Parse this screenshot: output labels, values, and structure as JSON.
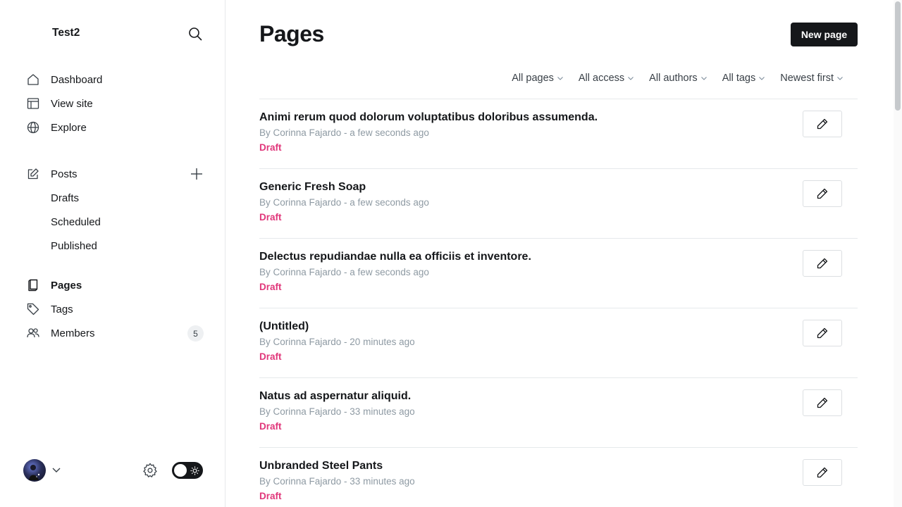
{
  "sidebar": {
    "site_title": "Test2",
    "nav": [
      {
        "label": "Dashboard",
        "icon": "home-icon"
      },
      {
        "label": "View site",
        "icon": "layout-icon"
      },
      {
        "label": "Explore",
        "icon": "globe-icon"
      }
    ],
    "posts": {
      "label": "Posts",
      "subitems": [
        "Drafts",
        "Scheduled",
        "Published"
      ]
    },
    "pages_label": "Pages",
    "tags_label": "Tags",
    "members": {
      "label": "Members",
      "count": "5"
    }
  },
  "main": {
    "title": "Pages",
    "new_button": "New page",
    "filters": [
      "All pages",
      "All access",
      "All authors",
      "All tags",
      "Newest first"
    ],
    "rows": [
      {
        "title": "Animi rerum quod dolorum voluptatibus doloribus assumenda.",
        "meta": "By Corinna Fajardo - a few seconds ago",
        "status": "Draft"
      },
      {
        "title": "Generic Fresh Soap",
        "meta": "By Corinna Fajardo - a few seconds ago",
        "status": "Draft"
      },
      {
        "title": "Delectus repudiandae nulla ea officiis et inventore.",
        "meta": "By Corinna Fajardo - a few seconds ago",
        "status": "Draft"
      },
      {
        "title": "(Untitled)",
        "meta": "By Corinna Fajardo - 20 minutes ago",
        "status": "Draft"
      },
      {
        "title": "Natus ad aspernatur aliquid.",
        "meta": "By Corinna Fajardo - 33 minutes ago",
        "status": "Draft"
      },
      {
        "title": "Unbranded Steel Pants",
        "meta": "By Corinna Fajardo - 33 minutes ago",
        "status": "Draft"
      }
    ]
  },
  "colors": {
    "accent_dark": "#15171a",
    "draft_pink": "#e0367a",
    "muted_text": "#8e9aa3",
    "border": "#e6e9eb"
  }
}
